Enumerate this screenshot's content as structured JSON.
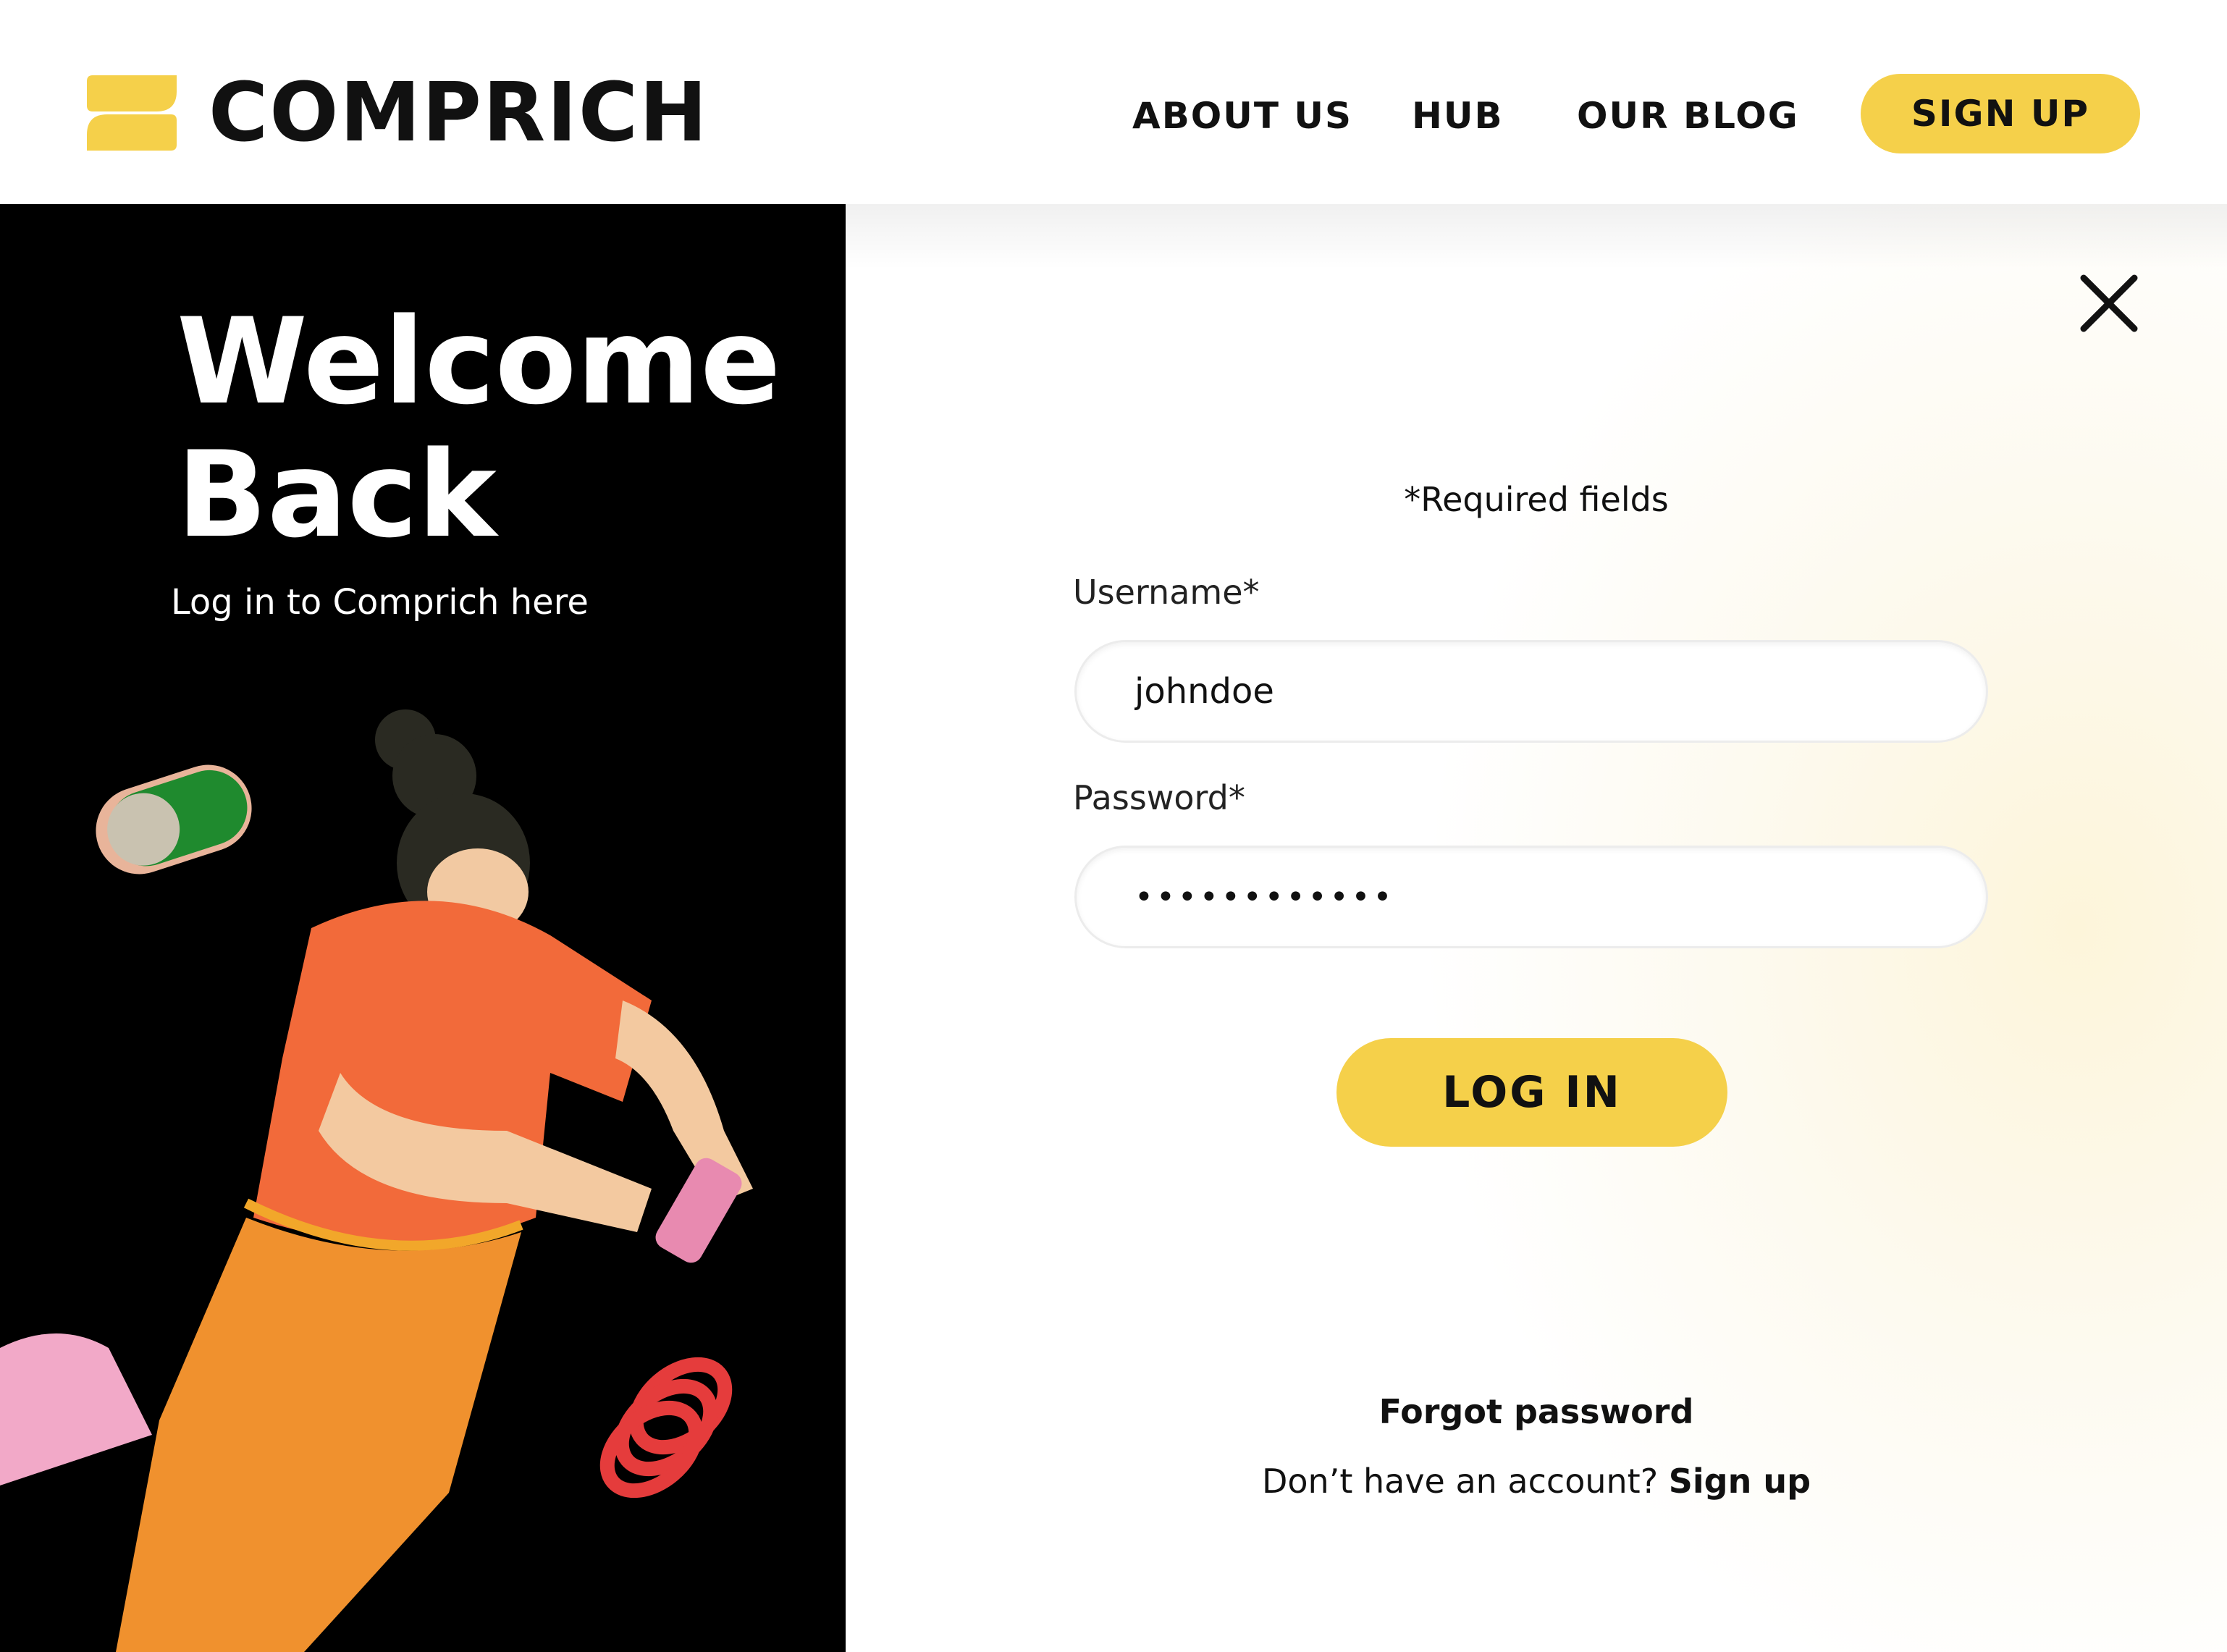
{
  "brand": {
    "name": "COMPRICH",
    "logo_icon": "stacked-bars-logo-icon",
    "accent_color": "#f5d04a"
  },
  "nav": {
    "about": "ABOUT US",
    "hub": "HUB",
    "blog": "OUR BLOG",
    "signup": "SIGN UP"
  },
  "hero": {
    "title_line1": "Welcome",
    "title_line2": "Back",
    "subtitle": "Log in to Comprich here"
  },
  "form": {
    "required_note": "*Required fields",
    "username_label": "Username*",
    "username_value": "johndoe",
    "password_label": "Password*",
    "password_value": "••••••••••••",
    "login_button": "LOG IN",
    "forgot_password": "Forgot password",
    "no_account_text": "Don’t have an account?",
    "signup_link": "Sign up",
    "close_icon": "close-icon"
  }
}
